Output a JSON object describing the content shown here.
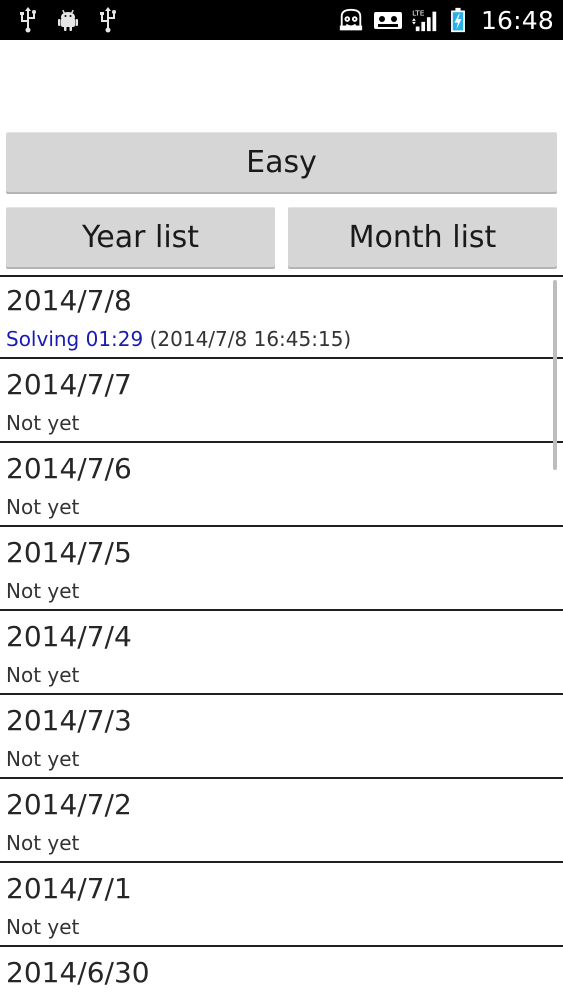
{
  "status_bar": {
    "time": "16:48",
    "network": "LTE",
    "icons_left": [
      "usb-icon",
      "android-debug-icon",
      "usb-icon"
    ],
    "icons_right": [
      "face-notification-icon",
      "voicemail-icon",
      "signal-icon",
      "battery-charging-icon"
    ]
  },
  "buttons": {
    "easy": "Easy",
    "year_list": "Year list",
    "month_list": "Month list"
  },
  "list": {
    "items": [
      {
        "date": "2014/7/8",
        "status_prefix": "Solving 01:29",
        "status_suffix": " (2014/7/8 16:45:15)"
      },
      {
        "date": "2014/7/7",
        "status": "Not yet"
      },
      {
        "date": "2014/7/6",
        "status": "Not yet"
      },
      {
        "date": "2014/7/5",
        "status": "Not yet"
      },
      {
        "date": "2014/7/4",
        "status": "Not yet"
      },
      {
        "date": "2014/7/3",
        "status": "Not yet"
      },
      {
        "date": "2014/7/2",
        "status": "Not yet"
      },
      {
        "date": "2014/7/1",
        "status": "Not yet"
      },
      {
        "date": "2014/6/30",
        "status": ""
      }
    ]
  },
  "colors": {
    "solving": "#1a1ab5",
    "button_bg": "#d6d6d6",
    "status_bar_bg": "#000000"
  }
}
